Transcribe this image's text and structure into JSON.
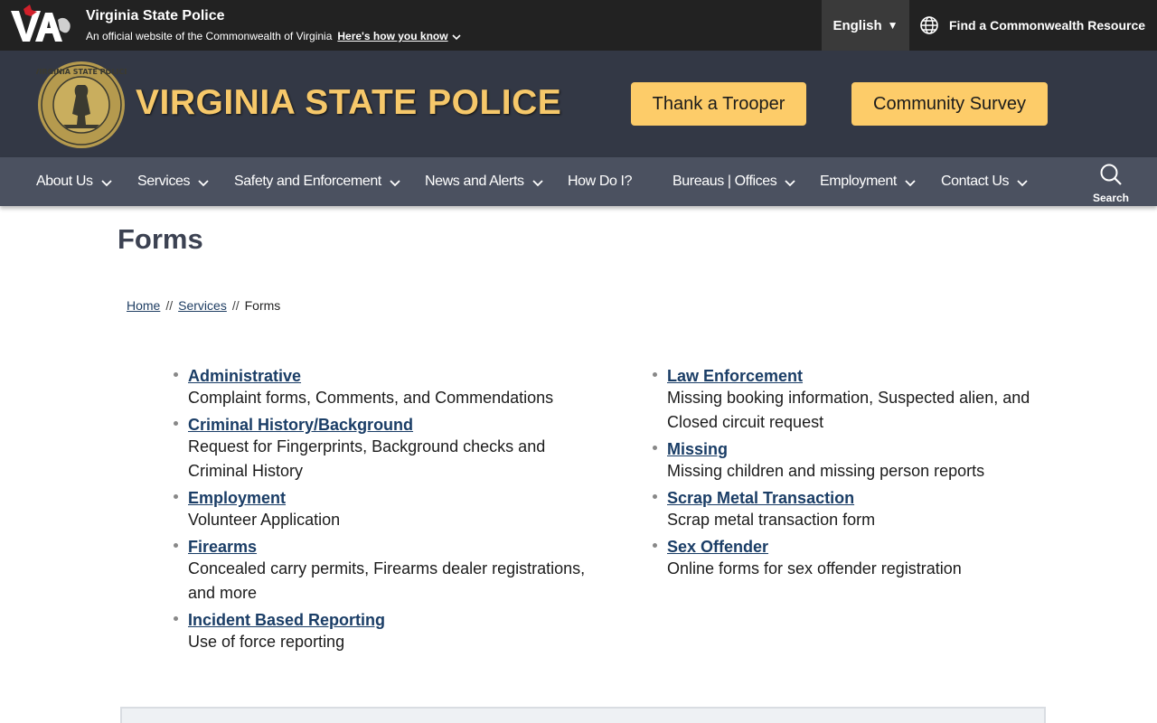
{
  "topbar": {
    "site_name": "Virginia State Police",
    "official_text": "An official website of the Commonwealth of Virginia",
    "how_link": "Here's how you know",
    "language": "English",
    "resource_link": "Find a Commonwealth Resource"
  },
  "header": {
    "agency_title": "VIRGINIA STATE POLICE",
    "cta_1": "Thank a Trooper",
    "cta_2": "Community Survey"
  },
  "nav": {
    "items": [
      {
        "label": "About Us"
      },
      {
        "label": "Services"
      },
      {
        "label": "Safety and Enforcement"
      },
      {
        "label": "News and Alerts"
      },
      {
        "label": "How Do I?"
      },
      {
        "label": "Bureaus | Offices"
      },
      {
        "label": "Employment"
      },
      {
        "label": "Contact Us"
      }
    ],
    "search_label": "Search"
  },
  "page": {
    "title": "Forms",
    "breadcrumb": {
      "home": "Home",
      "services": "Services",
      "current": "Forms",
      "separator": "//"
    }
  },
  "forms": {
    "left": [
      {
        "title": "Administrative",
        "desc": "Complaint forms, Comments, and Commendations"
      },
      {
        "title": "Criminal History/Background",
        "desc": "Request for Fingerprints, Background checks and Criminal History"
      },
      {
        "title": "Employment",
        "desc": "Volunteer Application"
      },
      {
        "title": "Firearms",
        "desc": "Concealed carry permits, Firearms dealer registrations, and more"
      },
      {
        "title": "Incident Based Reporting",
        "desc": "Use of force reporting"
      }
    ],
    "right": [
      {
        "title": "Law Enforcement",
        "desc": "Missing booking information, Suspected alien, and Closed circuit request"
      },
      {
        "title": "Missing",
        "desc": "Missing children and missing person reports"
      },
      {
        "title": "Scrap Metal Transaction",
        "desc": "Scrap metal transaction form"
      },
      {
        "title": "Sex Offender",
        "desc": "Online forms for sex offender registration"
      }
    ]
  },
  "colors": {
    "topbar": "#222222",
    "header": "#333845",
    "nav": "#4b5160",
    "gold": "#f6c86a",
    "cta": "#fdcc69",
    "link": "#1a3d66"
  }
}
